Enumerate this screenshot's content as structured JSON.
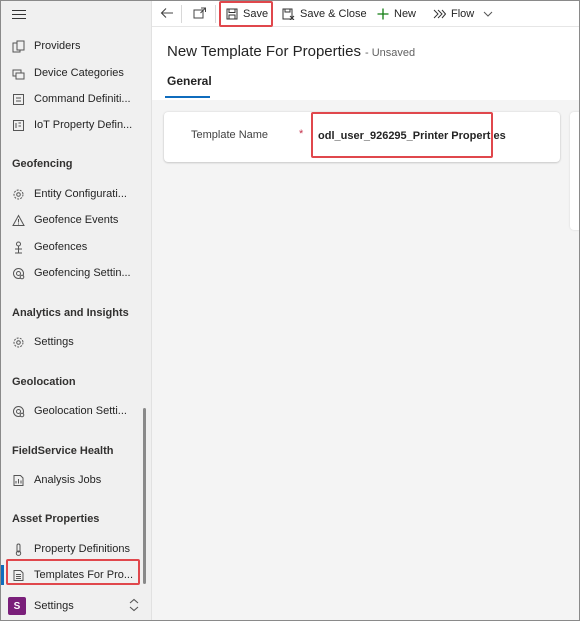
{
  "sidebar": {
    "top_items": [
      {
        "label": "Providers",
        "icon": "providers-icon"
      },
      {
        "label": "Device Categories",
        "icon": "device-categories-icon"
      },
      {
        "label": "Command Definiti...",
        "icon": "command-definitions-icon"
      },
      {
        "label": "IoT Property Defin...",
        "icon": "iot-property-icon"
      }
    ],
    "groups": {
      "geofencing": {
        "title": "Geofencing",
        "items": [
          {
            "label": "Entity Configurati...",
            "icon": "gear-icon"
          },
          {
            "label": "Geofence Events",
            "icon": "warning-triangle-icon"
          },
          {
            "label": "Geofences",
            "icon": "person-pin-icon"
          },
          {
            "label": "Geofencing Settin...",
            "icon": "location-settings-icon"
          }
        ]
      },
      "analytics": {
        "title": "Analytics and Insights",
        "items": [
          {
            "label": "Settings",
            "icon": "gear-icon"
          }
        ]
      },
      "geolocation": {
        "title": "Geolocation",
        "items": [
          {
            "label": "Geolocation Setti...",
            "icon": "location-settings-icon"
          }
        ]
      },
      "health": {
        "title": "FieldService Health",
        "items": [
          {
            "label": "Analysis Jobs",
            "icon": "analysis-jobs-icon"
          }
        ]
      },
      "asset": {
        "title": "Asset Properties",
        "items": [
          {
            "label": "Property Definitions",
            "icon": "thermometer-icon"
          },
          {
            "label": "Templates For Pro...",
            "icon": "document-icon"
          }
        ]
      }
    },
    "area": {
      "badge": "S",
      "label": "Settings"
    }
  },
  "commandbar": {
    "save": "Save",
    "save_close": "Save & Close",
    "new": "New",
    "flow": "Flow"
  },
  "form": {
    "title": "New Template For Properties",
    "status": "- Unsaved",
    "tab": "General",
    "field_label": "Template Name",
    "required_marker": "*",
    "field_value": "odl_user_926295_Printer Properties"
  },
  "colors": {
    "accent": "#0f6cbd",
    "highlight": "#e0474c",
    "area_badge": "#7a1f7a",
    "required": "#c4314b"
  }
}
